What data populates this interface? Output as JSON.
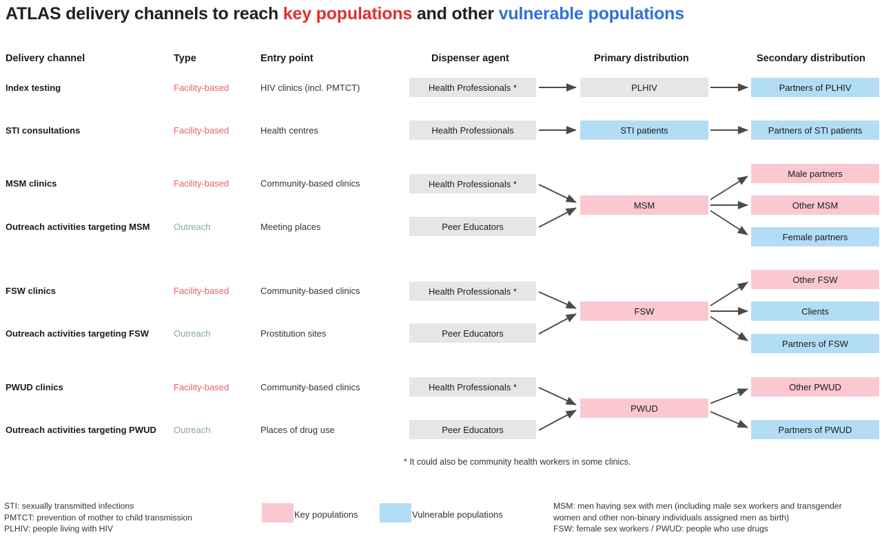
{
  "title": {
    "part1": "ATLAS delivery channels to reach ",
    "key": "key populations",
    "part2": " and other ",
    "vulnerable": "vulnerable populations"
  },
  "colors": {
    "key_populations": "#fbc8d0",
    "vulnerable_populations": "#b3ddf5",
    "neutral": "#e6e6e6",
    "facility_based": "#ef5a6a",
    "outreach": "#8ba3a6",
    "title_key": "#e03030",
    "title_vulnerable": "#2d72d9",
    "arrow": "#4a4a4a"
  },
  "headers": {
    "delivery_channel": "Delivery channel",
    "type": "Type",
    "entry_point": "Entry point",
    "dispenser_agent": "Dispenser agent",
    "primary_distribution": "Primary distribution",
    "secondary_distribution": "Secondary distribution"
  },
  "rows": [
    {
      "channel": "Index testing",
      "type": "Facility-based",
      "entry": "HIV clinics (incl. PMTCT)"
    },
    {
      "channel": "STI consultations",
      "type": "Facility-based",
      "entry": "Health centres"
    },
    {
      "channel": "MSM clinics",
      "type": "Facility-based",
      "entry": "Community-based clinics"
    },
    {
      "channel": "Outreach activities targeting MSM",
      "type": "Outreach",
      "entry": "Meeting places"
    },
    {
      "channel": "FSW clinics",
      "type": "Facility-based",
      "entry": "Community-based clinics"
    },
    {
      "channel": "Outreach activities targeting FSW",
      "type": "Outreach",
      "entry": "Prostitution sites"
    },
    {
      "channel": "PWUD clinics",
      "type": "Facility-based",
      "entry": "Community-based clinics"
    },
    {
      "channel": "Outreach activities targeting PWUD",
      "type": "Outreach",
      "entry": "Places of drug use"
    }
  ],
  "dispensers": [
    {
      "label": "Health Professionals *"
    },
    {
      "label": "Health Professionals"
    },
    {
      "label": "Health Professionals *"
    },
    {
      "label": "Peer Educators"
    },
    {
      "label": "Health Professionals *"
    },
    {
      "label": "Peer Educators"
    },
    {
      "label": "Health Professionals *"
    },
    {
      "label": "Peer Educators"
    }
  ],
  "primary": [
    {
      "label": "PLHIV",
      "category": "neutral"
    },
    {
      "label": "STI patients",
      "category": "vulnerable"
    },
    {
      "label": "MSM",
      "category": "key"
    },
    {
      "label": "FSW",
      "category": "key"
    },
    {
      "label": "PWUD",
      "category": "key"
    }
  ],
  "secondary": [
    {
      "label": "Partners of PLHIV",
      "category": "vulnerable"
    },
    {
      "label": "Partners of STI patients",
      "category": "vulnerable"
    },
    {
      "label": "Male partners",
      "category": "key"
    },
    {
      "label": "Other MSM",
      "category": "key"
    },
    {
      "label": "Female partners",
      "category": "vulnerable"
    },
    {
      "label": "Other FSW",
      "category": "key"
    },
    {
      "label": "Clients",
      "category": "vulnerable"
    },
    {
      "label": "Partners of FSW",
      "category": "vulnerable"
    },
    {
      "label": "Other PWUD",
      "category": "key"
    },
    {
      "label": "Partners of PWUD",
      "category": "vulnerable"
    }
  ],
  "footnote": "* It could also be community health workers in some clinics.",
  "legend": {
    "key_label": "Key populations",
    "vulnerable_label": "Vulnerable populations",
    "abbrev_left": [
      "STI: sexually transmitted infections",
      "PMTCT: prevention of mother to child transmission",
      "PLHIV: people living with HIV"
    ],
    "abbrev_right": [
      "MSM: men having sex with men (including male sex workers and transgender",
      "women and other non-binary individuals assigned men as birth)",
      "FSW: female sex workers          /          PWUD: people who use drugs"
    ]
  }
}
